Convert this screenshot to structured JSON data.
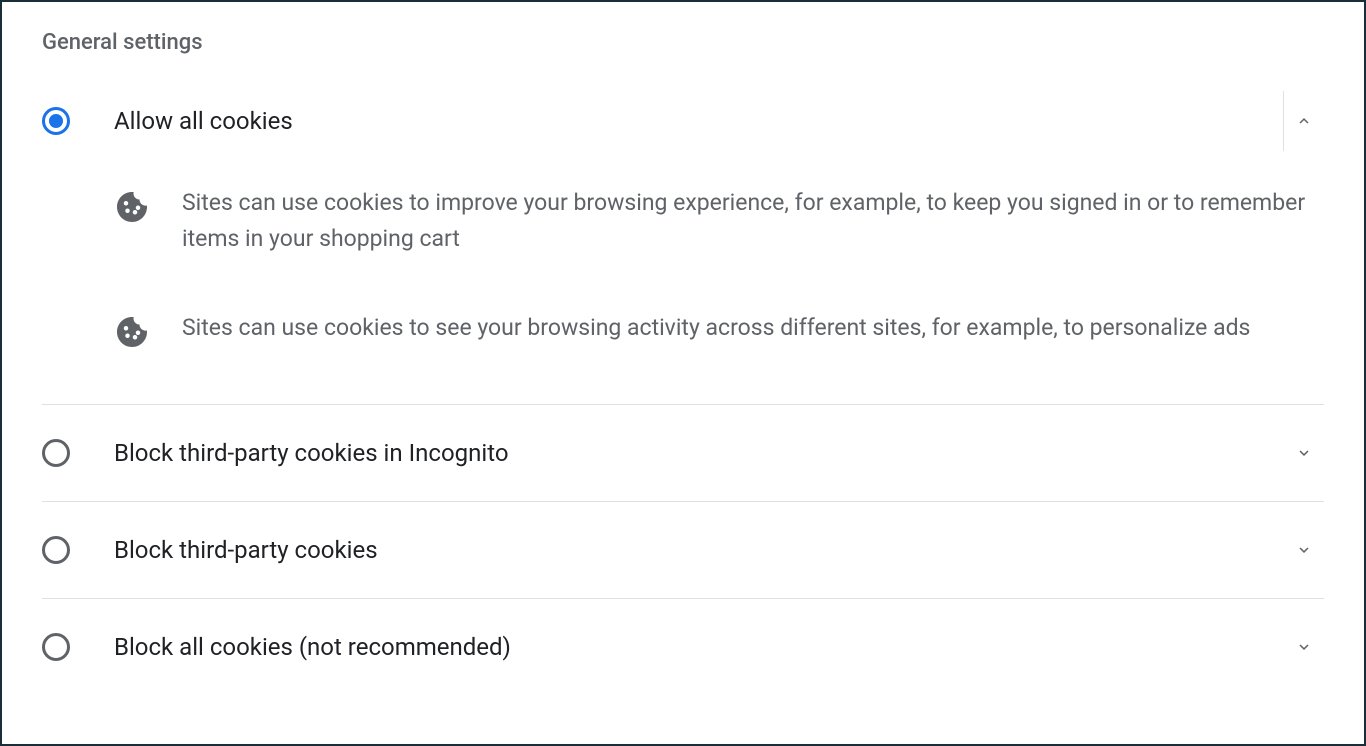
{
  "section_title": "General settings",
  "options": [
    {
      "label": "Allow all cookies",
      "selected": true,
      "expanded": true,
      "details": [
        "Sites can use cookies to improve your browsing experience, for example, to keep you signed in or to remember items in your shopping cart",
        "Sites can use cookies to see your browsing activity across different sites, for example, to personalize ads"
      ]
    },
    {
      "label": "Block third-party cookies in Incognito",
      "selected": false,
      "expanded": false
    },
    {
      "label": "Block third-party cookies",
      "selected": false,
      "expanded": false
    },
    {
      "label": "Block all cookies (not recommended)",
      "selected": false,
      "expanded": false
    }
  ]
}
